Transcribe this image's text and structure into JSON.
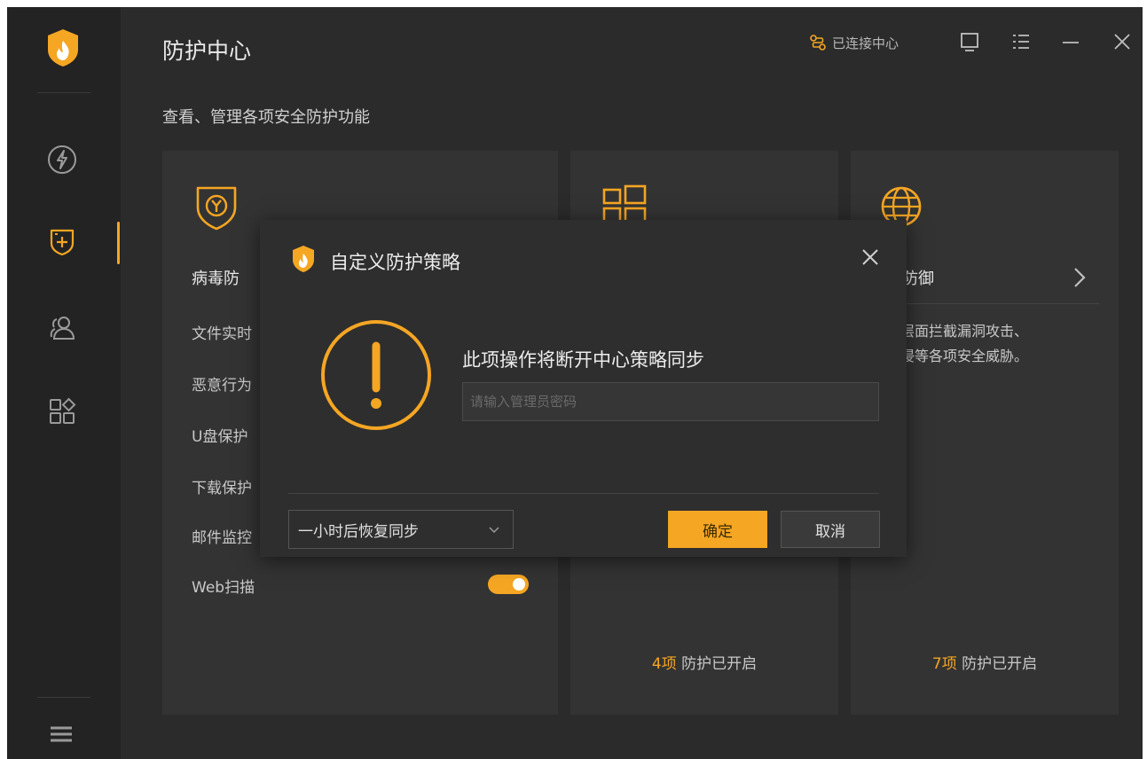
{
  "app": {
    "title": "防护中心",
    "subtitle": "查看、管理各项安全防护功能",
    "connection_status": "已连接中心"
  },
  "colors": {
    "accent": "#f5a623",
    "background": "#2b2b2b",
    "sidebar": "#232323",
    "card": "#333333"
  },
  "sidebar": {
    "items": [
      {
        "icon": "lightning-icon"
      },
      {
        "icon": "shield-plus-icon",
        "active": true
      },
      {
        "icon": "users-icon"
      },
      {
        "icon": "apps-grid-icon"
      }
    ],
    "menu_icon": "hamburger-menu-icon"
  },
  "cards": {
    "virus": {
      "title": "病毒防",
      "items": [
        "文件实时",
        "恶意行为",
        "U盘保护",
        "下载保护",
        "邮件监控",
        "Web扫描"
      ],
      "web_scan_enabled": true
    },
    "system": {
      "status_count": "4项",
      "status_text": "防护已开启"
    },
    "network": {
      "title": "络防御",
      "desc_line1": "络层面拦截漏洞攻击、",
      "desc_line2": "入侵等各项安全威胁。",
      "status_count": "7项",
      "status_text": "防护已开启"
    }
  },
  "dialog": {
    "title": "自定义防护策略",
    "message": "此项操作将断开中心策略同步",
    "password_placeholder": "请输入管理员密码",
    "password_value": "",
    "resume_option": "一小时后恢复同步",
    "ok_label": "确定",
    "cancel_label": "取消"
  }
}
